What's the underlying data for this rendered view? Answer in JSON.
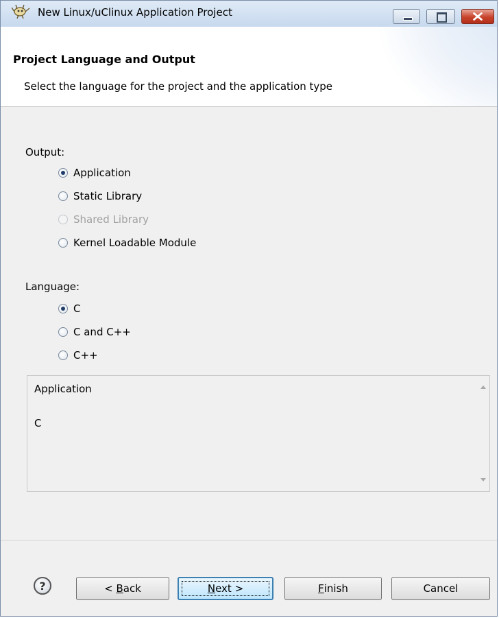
{
  "window": {
    "title": "New Linux/uClinux Application Project"
  },
  "banner": {
    "title": "Project Language and Output",
    "description": "Select the language for the project and the application type"
  },
  "output": {
    "label": "Output:",
    "options": [
      {
        "label": "Application",
        "selected": true,
        "enabled": true
      },
      {
        "label": "Static Library",
        "selected": false,
        "enabled": true
      },
      {
        "label": "Shared Library",
        "selected": false,
        "enabled": false
      },
      {
        "label": "Kernel Loadable Module",
        "selected": false,
        "enabled": true
      }
    ]
  },
  "language": {
    "label": "Language:",
    "options": [
      {
        "label": "C",
        "selected": true,
        "enabled": true
      },
      {
        "label": "C and C++",
        "selected": false,
        "enabled": true
      },
      {
        "label": "C++",
        "selected": false,
        "enabled": true
      }
    ]
  },
  "summary": {
    "line1": "Application",
    "line2": "C"
  },
  "buttons": {
    "help_glyph": "?",
    "back": {
      "prefix": "< ",
      "mnemonic": "B",
      "rest": "ack"
    },
    "next": {
      "mnemonic": "N",
      "rest": "ext >"
    },
    "finish": {
      "mnemonic": "F",
      "rest": "inish"
    },
    "cancel": "Cancel"
  },
  "colors": {
    "default_button_border": "#3c7fb1",
    "close_button": "#c8432b",
    "titlebar": "#c7d9ee"
  }
}
